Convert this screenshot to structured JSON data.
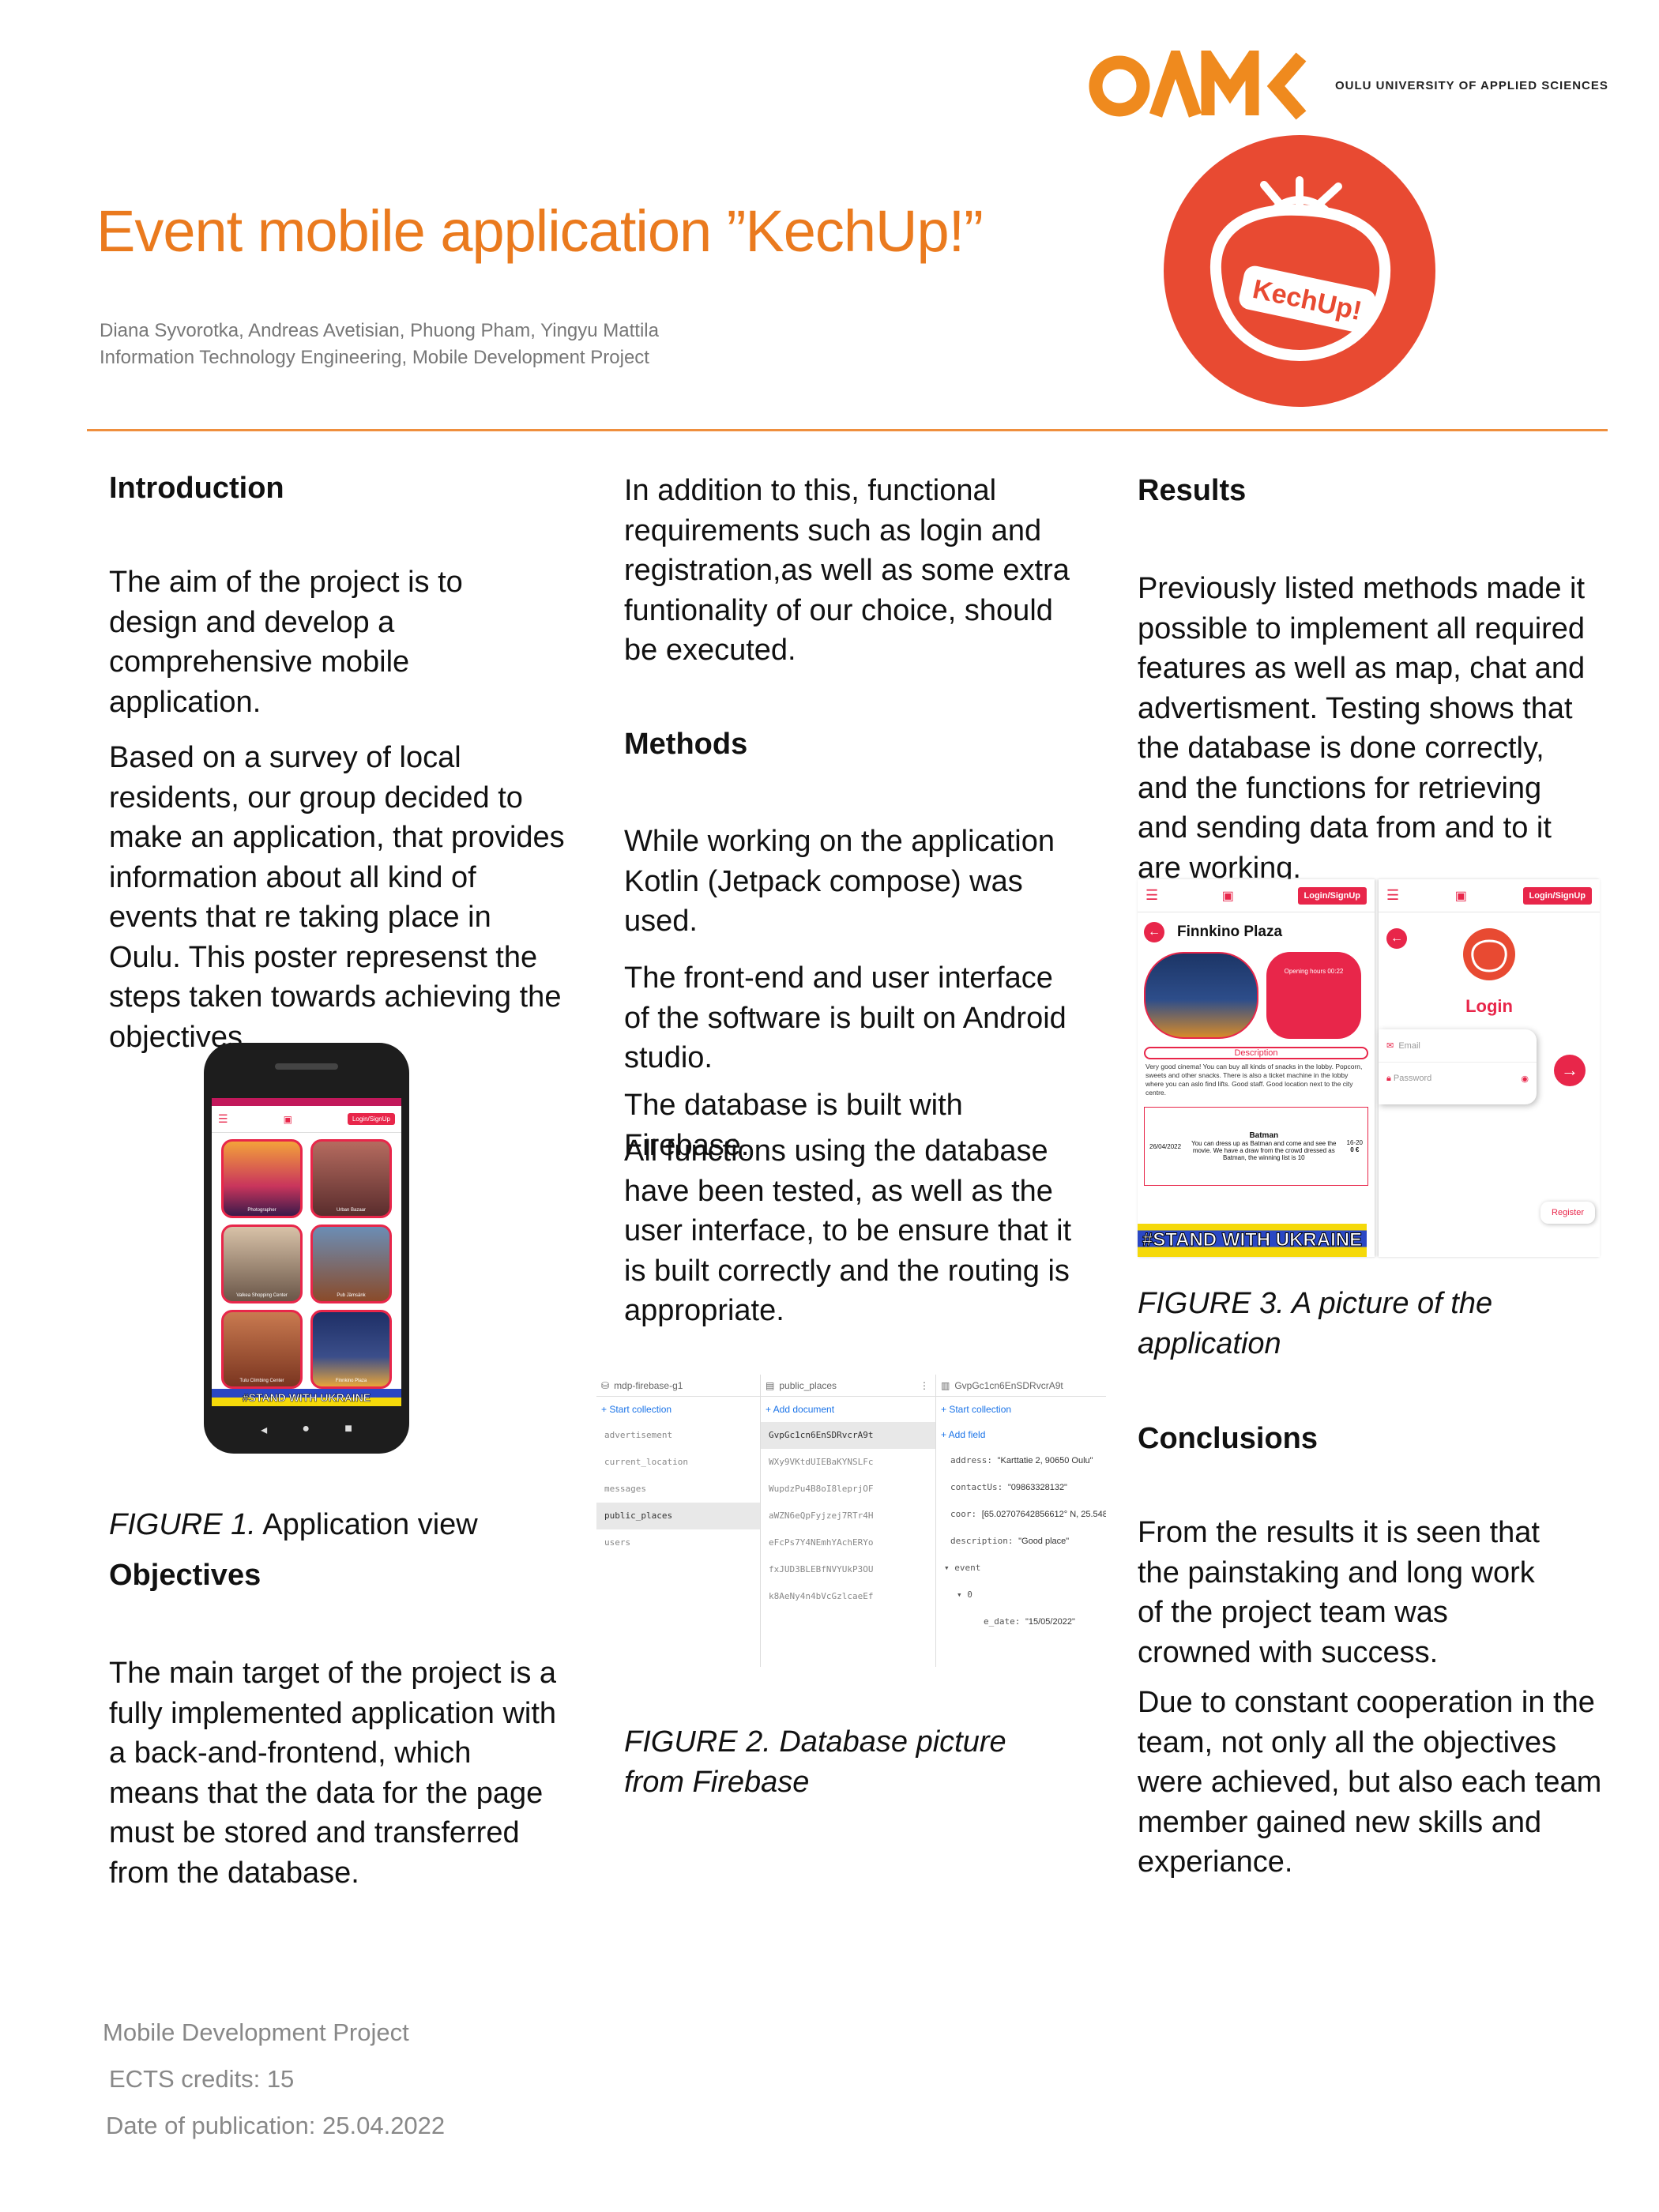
{
  "header": {
    "logo_text": "OAMK",
    "logo_subtitle": "OULU UNIVERSITY OF APPLIED SCIENCES",
    "title": "Event mobile application  ”KechUp!”",
    "authors": "Diana Syvorotka, Andreas Avetisian, Phuong Pham, Yingyu Mattila",
    "program": "Information Technology Engineering, Mobile Development Project",
    "app_logo_text": "KechUp!"
  },
  "col1": {
    "intro_heading": "Introduction",
    "intro_p1": "The aim of the project is to design and develop a comprehensive mobile application.",
    "intro_p2": "Based on a survey of local residents, our group decided to make an application, that provides information about all kind of events that re taking place in Oulu. This poster represenst the steps taken towards achieving the objectives.",
    "fig1_label": "FIGURE 1.",
    "fig1_text": " Application view",
    "objectives_heading": "Objectives",
    "objectives_p": "The main target of the project is a fully implemented application with a back-and-frontend, which means that the data for the page must be stored and transferred from the database."
  },
  "phone": {
    "login_btn": "Login/SignUp",
    "tiles": [
      "Photographer",
      "Urban Bazaar",
      "Valkea Shopping Center",
      "Pub Jämsänk",
      "Tulu Climbing Center",
      "Finnkino Plaza"
    ],
    "banner": "#STAND WITH UKRAINE"
  },
  "col2": {
    "p1": "In addition to this, functional requirements such as login and registration,as well as some extra funtionality of our choice, should be executed.",
    "methods_heading": "Methods",
    "p2": "While working on the application Kotlin (Jetpack compose) was used.",
    "p3": "The front-end and user interface of the software is built on Android studio.",
    "p4": "The database is built with Firebase.",
    "p5": "All functions using the database have been tested, as well as the user interface, to be ensure that it is built correctly and the routing is appropriate.",
    "fig2_caption": "FIGURE 2. Database picture from Firebase"
  },
  "firebase": {
    "project": "mdp-firebase-g1",
    "collection": "public_places",
    "document": "GvpGc1cn6EnSDRvcrA9t",
    "start_collection": "+ Start collection",
    "add_document": "+ Add document",
    "add_field": "+ Add field",
    "collections": [
      "advertisement",
      "current_location",
      "messages",
      "public_places",
      "users"
    ],
    "documents": [
      "GvpGc1cn6EnSDRvcrA9t",
      "WXy9VKtdUIEBaKYNSLFc",
      "WupdzPu4B8oI8leprjOF",
      "aWZN6eQpFyjzej7RTr4H",
      "eFcPs7Y4NEmhYAchERYo",
      "fxJUD3BLEBfNVYUkP3OU",
      "k8AeNy4n4bVcGzlcaeEf"
    ],
    "fields": [
      {
        "key": "address:",
        "value": "\"Karttatie 2, 90650 Oulu\""
      },
      {
        "key": "contactUs:",
        "value": "\"09863328132\""
      },
      {
        "key": "coor:",
        "value": "[65.02707642856612° N, 25.548"
      },
      {
        "key": "description:",
        "value": "\"Good place\""
      },
      {
        "key": "▾ event",
        "value": ""
      },
      {
        "key": "▾ 0",
        "value": ""
      },
      {
        "key": "e_date:",
        "value": "\"15/05/2022\""
      }
    ]
  },
  "col3": {
    "results_heading": "Results",
    "results_p": "Previously listed methods made it possible to implement all required features as well as map, chat and advertisment. Testing shows that the database is done correctly, and the functions for retrieving and sending data from and to it are working.",
    "fig3_caption": "FIGURE 3. A picture of the application",
    "conclusions_heading": "Conclusions",
    "concl_p1": "From the results it is seen that the painstaking and long work of the project team was crowned with success.",
    "concl_p2": "Due to constant cooperation in the team, not only all the objectives were achieved, but also each team member gained new skills and experiance."
  },
  "shot1": {
    "login_btn": "Login/SignUp",
    "place_title": "Finnkino Plaza",
    "info": "Opening hours 00:22",
    "desc_label": "Description",
    "desc_text": "Very good cinema! You can buy all kinds of snacks in the lobby. Popcorn, sweets and other snacks. There is also a ticket machine in the lobby where you can aslo find lifts. Good staff. Good location next to the city centre.",
    "event_title": "Batman",
    "event_text": "You can dress up as Batman and come and see the movie. We have a draw from the crowd dressed as Batman, the winning list is 10",
    "event_date": "26/04/2022",
    "event_time": "16-20",
    "event_price": "0 €",
    "banner": "#STAND WITH UKRAINE"
  },
  "shot2": {
    "login_btn": "Login/SignUp",
    "login_title": "Login",
    "email_label": "Email",
    "password_label": "Password",
    "register_btn": "Register"
  },
  "footer": {
    "line1": "Mobile Development Project",
    "line2": "ECTS credits: 15",
    "line3": "Date of publication: 25.04.2022"
  },
  "colors": {
    "orange": "#ea7a1e",
    "red": "#e8264a",
    "logo_red": "#e84a32"
  }
}
